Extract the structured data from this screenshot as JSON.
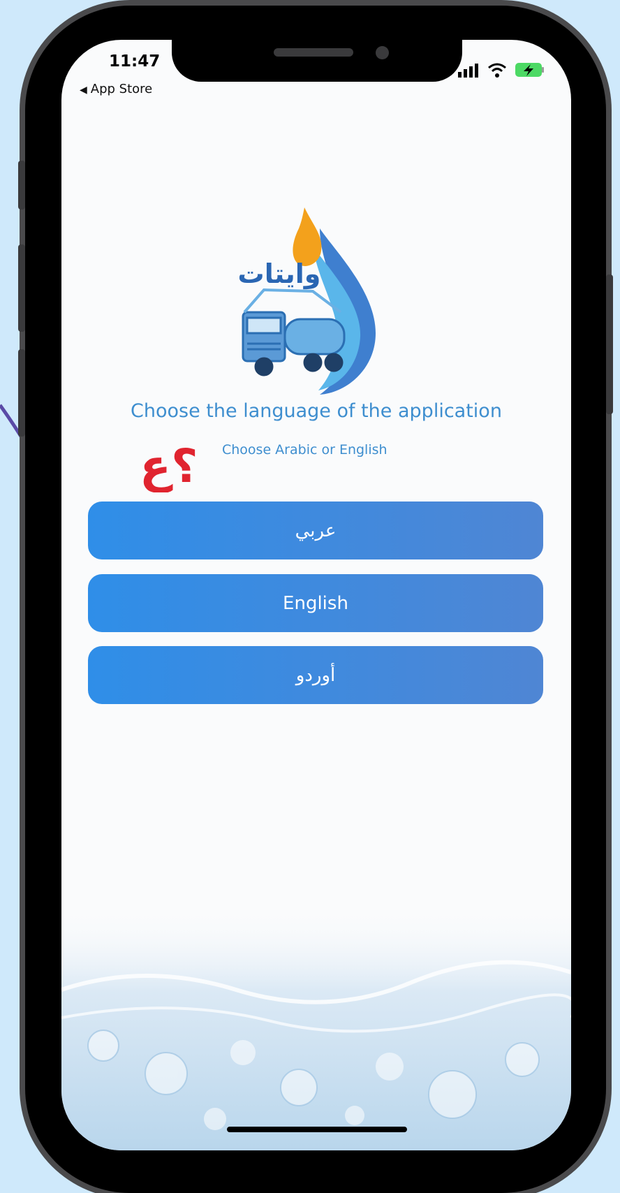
{
  "status_bar": {
    "time": "11:47",
    "back_label": "App Store"
  },
  "logo": {
    "brand_text": "وايتات"
  },
  "language_screen": {
    "title": "Choose the language of the application",
    "subtitle": "Choose Arabic or English",
    "annotation_mark": "؟ع"
  },
  "buttons": [
    {
      "label": "عربي"
    },
    {
      "label": "English"
    },
    {
      "label": "أوردو"
    }
  ],
  "colors": {
    "background": "#cfe9fb",
    "accent": "#3e8ecf",
    "button": "#2f8ee8",
    "annotation": "#e0242f"
  },
  "icons": [
    "signal-icon",
    "wifi-icon",
    "battery-charging-icon",
    "back-arrow-icon",
    "truck-icon",
    "water-drop-icon"
  ]
}
